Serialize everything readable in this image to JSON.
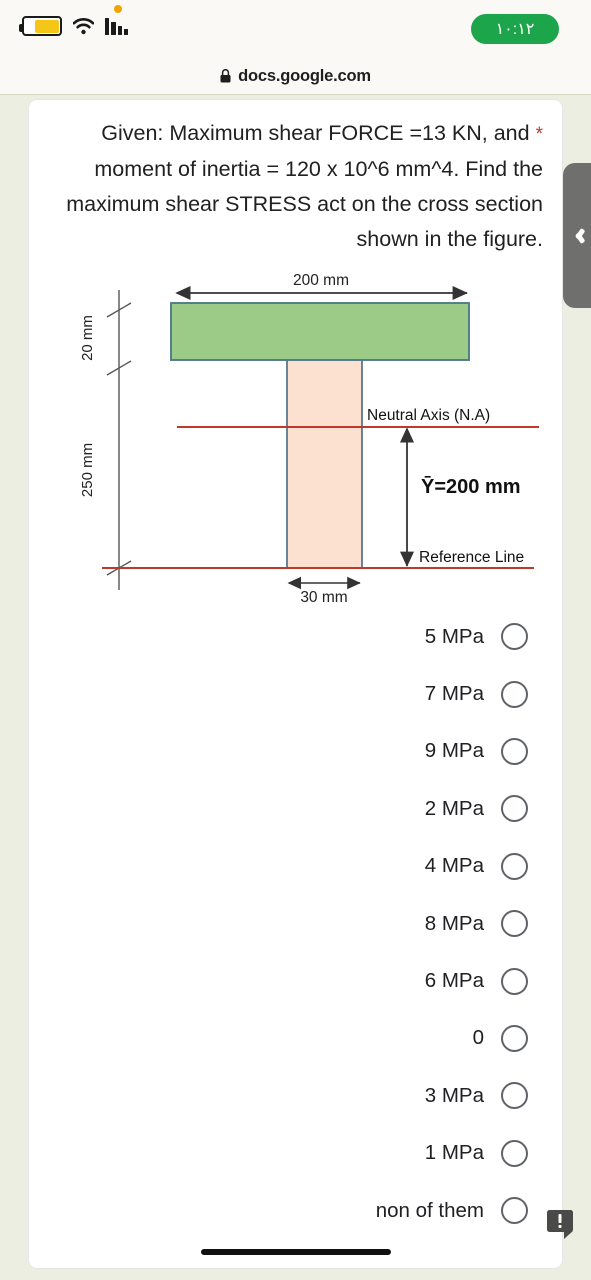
{
  "status_bar": {
    "time": "١٠:١٢",
    "battery_icon": "battery-icon",
    "wifi_icon": "wifi-icon",
    "signal_icon": "signal-bars-icon",
    "notification_dot": "orange-dot-indicator",
    "clock_pill_color": "#1ca54a"
  },
  "browser": {
    "lock_icon": "lock-icon",
    "url": "docs.google.com"
  },
  "question": {
    "required_marker": "*",
    "text": "Given: Maximum shear FORCE =13 KN, and moment of inertia = 120 x 10^6 mm^4. Find the maximum shear STRESS act on the cross section shown in the figure."
  },
  "figure": {
    "alt": "T-section cross-section diagram",
    "flange_label": "200 mm",
    "flange_thickness_label": "20 mm",
    "web_height_label": "250 mm",
    "web_width_label": "30 mm",
    "neutral_axis_label": "Neutral Axis (N.A)",
    "centroid_label": "Ȳ=200 mm",
    "reference_line_label": "Reference Line",
    "flange_fill": "#9ccb87",
    "flange_stroke": "#4f7a8c",
    "web_fill": "#fce0d0",
    "web_stroke": "#4f6f8c",
    "axis_line_color": "#c0392b",
    "dimension_line_color": "#333333"
  },
  "options": [
    {
      "label": "5 MPa",
      "selected": false
    },
    {
      "label": "7 MPa",
      "selected": false
    },
    {
      "label": "9 MPa",
      "selected": false
    },
    {
      "label": "2 MPa",
      "selected": false
    },
    {
      "label": "4 MPa",
      "selected": false
    },
    {
      "label": "8 MPa",
      "selected": false
    },
    {
      "label": "6 MPa",
      "selected": false
    },
    {
      "label": "0",
      "selected": false
    },
    {
      "label": "3 MPa",
      "selected": false
    },
    {
      "label": "1 MPa",
      "selected": false
    },
    {
      "label": "non of them",
      "selected": false
    }
  ],
  "edge_tab": {
    "icon": "chevron-left-icon"
  },
  "feedback_button": {
    "icon": "feedback-exclamation-icon"
  },
  "home_indicator": {
    "name": "home-indicator"
  }
}
